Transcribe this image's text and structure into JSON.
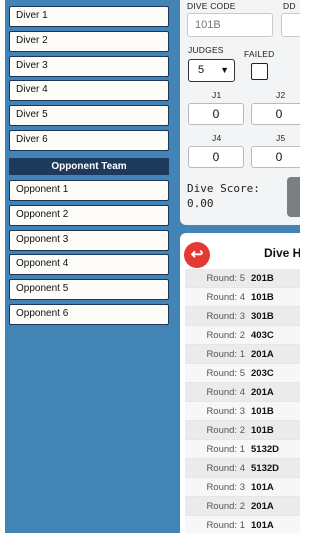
{
  "divers": {
    "items": [
      "Diver 1",
      "Diver 2",
      "Diver 3",
      "Diver 4",
      "Diver 5",
      "Diver 6"
    ]
  },
  "opponents": {
    "header": "Opponent Team",
    "items": [
      "Opponent 1",
      "Opponent 2",
      "Opponent 3",
      "Opponent 4",
      "Opponent 5",
      "Opponent 6"
    ]
  },
  "scoring": {
    "dive_code_label": "DIVE CODE",
    "dive_code_value": "101B",
    "dd_label": "DD",
    "judges_label": "JUDGES",
    "judges_value": "5",
    "failed_label": "FAILED",
    "judges": [
      {
        "label": "J1",
        "value": "0"
      },
      {
        "label": "J2",
        "value": "0"
      },
      {
        "label": "J4",
        "value": "0"
      },
      {
        "label": "J5",
        "value": "0"
      }
    ],
    "dive_score_label": "Dive Score:",
    "dive_score_value": "0.00"
  },
  "history": {
    "title": "Dive H",
    "back_icon": "↩",
    "rows": [
      {
        "round": "Round: 5",
        "code": "201B"
      },
      {
        "round": "Round: 4",
        "code": "101B"
      },
      {
        "round": "Round: 3",
        "code": "301B"
      },
      {
        "round": "Round: 2",
        "code": "403C"
      },
      {
        "round": "Round: 1",
        "code": "201A"
      },
      {
        "round": "Round: 5",
        "code": "203C"
      },
      {
        "round": "Round: 4",
        "code": "201A"
      },
      {
        "round": "Round: 3",
        "code": "101B"
      },
      {
        "round": "Round: 2",
        "code": "101B"
      },
      {
        "round": "Round: 1",
        "code": "5132D"
      },
      {
        "round": "Round: 4",
        "code": "5132D"
      },
      {
        "round": "Round: 3",
        "code": "101A"
      },
      {
        "round": "Round: 2",
        "code": "201A"
      },
      {
        "round": "Round: 1",
        "code": "101A"
      }
    ]
  },
  "colors": {
    "panel_bg": "#4384b7",
    "team_header_bg": "#1d3a5c",
    "back_button": "#e53935"
  }
}
